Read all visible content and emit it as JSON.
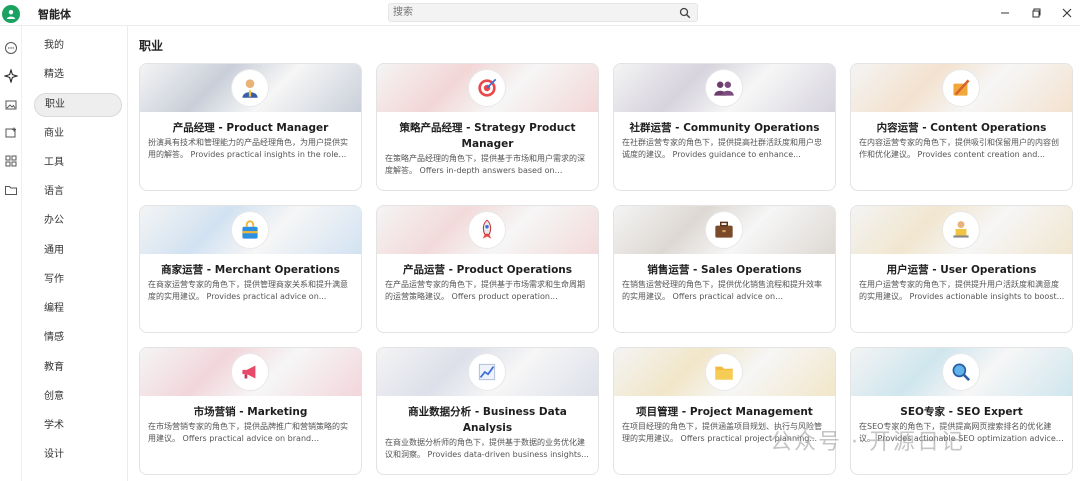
{
  "app": {
    "title": "智能体"
  },
  "search": {
    "placeholder": "搜索"
  },
  "rail": [
    "chat-icon",
    "agent-icon",
    "image-icon",
    "image-edit-icon",
    "grid-icon",
    "folder-icon"
  ],
  "categories": [
    "我的",
    "精选",
    "职业",
    "商业",
    "工具",
    "语言",
    "办公",
    "通用",
    "写作",
    "编程",
    "情感",
    "教育",
    "创意",
    "学术",
    "设计"
  ],
  "active_category": "职业",
  "section": {
    "title": "职业"
  },
  "cards": [
    {
      "title": "产品经理 - Product Manager",
      "desc": "扮演具有技术和管理能力的产品经理角色，为用户提供实用的解答。 Provides practical insights in the role of...",
      "icon": "person-icon",
      "color": "#c9cfd9"
    },
    {
      "title": "策略产品经理 - Strategy Product Manager",
      "desc": "在策略产品经理的角色下，提供基于市场和用户需求的深度解答。 Offers in-depth answers based on market...",
      "icon": "target-icon",
      "color": "#f3d6d6"
    },
    {
      "title": "社群运营 - Community Operations",
      "desc": "在社群运营专家的角色下，提供提高社群活跃度和用户忠诚度的建议。 Provides guidance to enhance...",
      "icon": "group-icon",
      "color": "#d6d3dd"
    },
    {
      "title": "内容运营 - Content Operations",
      "desc": "在内容运营专家的角色下，提供吸引和保留用户的内容创作和优化建议。 Provides content creation and...",
      "icon": "writing-icon",
      "color": "#f3e2cf"
    },
    {
      "title": "商家运营 - Merchant Operations",
      "desc": "在商家运营专家的角色下，提供管理商家关系和提升满意度的实用建议。 Provides practical advice on...",
      "icon": "shopping-bag-icon",
      "color": "#d2e2f2"
    },
    {
      "title": "产品运营 - Product Operations",
      "desc": "在产品运营专家的角色下，提供基于市场需求和生命周期的运营策略建议。 Offers product operation...",
      "icon": "rocket-icon",
      "color": "#f3dada"
    },
    {
      "title": "销售运营 - Sales Operations",
      "desc": "在销售运营经理的角色下，提供优化销售流程和提升效率的实用建议。 Offers practical advice on streamlinin...",
      "icon": "briefcase-icon",
      "color": "#ddd8d3"
    },
    {
      "title": "用户运营 - User Operations",
      "desc": "在用户运营专家的角色下，提供提升用户活跃度和满意度的实用建议。 Provides actionable insights to boost...",
      "icon": "user-laptop-icon",
      "color": "#f1e6cf"
    },
    {
      "title": "市场营销 - Marketing",
      "desc": "在市场营销专家的角色下，提供品牌推广和营销策略的实用建议。 Offers practical advice on brand promotio...",
      "icon": "megaphone-icon",
      "color": "#f2d6dc"
    },
    {
      "title": "商业数据分析 - Business Data Analysis",
      "desc": "在商业数据分析师的角色下，提供基于数据的业务优化建议和洞察。 Provides data-driven business insights...",
      "icon": "chart-icon",
      "color": "#dde0ea"
    },
    {
      "title": "项目管理 - Project Management",
      "desc": "在项目经理的角色下，提供涵盖项目规划、执行与风险管理的实用建议。 Offers practical project planning...",
      "icon": "folder-icon",
      "color": "#f2e6c8"
    },
    {
      "title": "SEO专家 - SEO Expert",
      "desc": "在SEO专家的角色下，提供提高网页搜索排名的优化建议。 Provides actionable SEO optimization advice to...",
      "icon": "magnifier-icon",
      "color": "#cfe6ee"
    }
  ],
  "watermark": "公众号 · 开源日记"
}
